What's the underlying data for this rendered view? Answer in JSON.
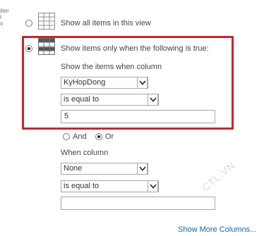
{
  "sidebar": {
    "fragment_lines": [
      "ilter",
      "t",
      "o"
    ]
  },
  "options": {
    "show_all_label": "Show all items in this view",
    "show_filtered_label": "Show items only when the following is true:"
  },
  "filter1": {
    "heading": "Show the items when column",
    "column_value": "KyHopDong",
    "operator_value": "is equal to",
    "value": "5"
  },
  "logic": {
    "and_label": "And",
    "or_label": "Or",
    "selected": "Or"
  },
  "filter2": {
    "heading": "When column",
    "column_value": "None",
    "operator_value": "is equal to",
    "value": ""
  },
  "footer": {
    "show_more_label": "Show More Columns..."
  },
  "watermark": "CTL.VN",
  "colors": {
    "highlight_border": "#c6262e",
    "link": "#1f5f9f"
  }
}
